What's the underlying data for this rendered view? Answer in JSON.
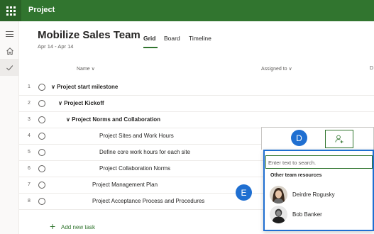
{
  "app": {
    "title": "Project"
  },
  "plan": {
    "title": "Mobilize Sales Team",
    "dates": "Apr 14 - Apr 14"
  },
  "views": {
    "tabs": [
      "Grid",
      "Board",
      "Timeline"
    ],
    "active": "Grid"
  },
  "columns": {
    "name": "Name ∨",
    "assigned": "Assigned to ∨",
    "cut_off": "D"
  },
  "rows": [
    {
      "num": "1",
      "name": "∨ Project start milestone",
      "bold": true
    },
    {
      "num": "2",
      "name": "∨ Project Kickoff",
      "bold": true
    },
    {
      "num": "3",
      "name": "∨ Project Norms and Collaboration",
      "bold": true
    },
    {
      "num": "4",
      "name": "Project Sites and Work Hours",
      "bold": false
    },
    {
      "num": "5",
      "name": "Define core work hours for each site",
      "bold": false
    },
    {
      "num": "6",
      "name": "Project Collaboration Norms",
      "bold": false
    },
    {
      "num": "7",
      "name": "Project Management Plan",
      "bold": false
    },
    {
      "num": "8",
      "name": "Project Acceptance Process and Procedures",
      "bold": false
    }
  ],
  "add_task": "Add new task",
  "callouts": {
    "d": "D",
    "e": "E"
  },
  "picker": {
    "placeholder": "Enter text to search.",
    "section": "Other team resources",
    "people": [
      {
        "name": "Deirdre Rogusky"
      },
      {
        "name": "Bob Banker"
      }
    ]
  },
  "colors": {
    "brand": "#31752f",
    "callout": "#1f6fd1"
  }
}
